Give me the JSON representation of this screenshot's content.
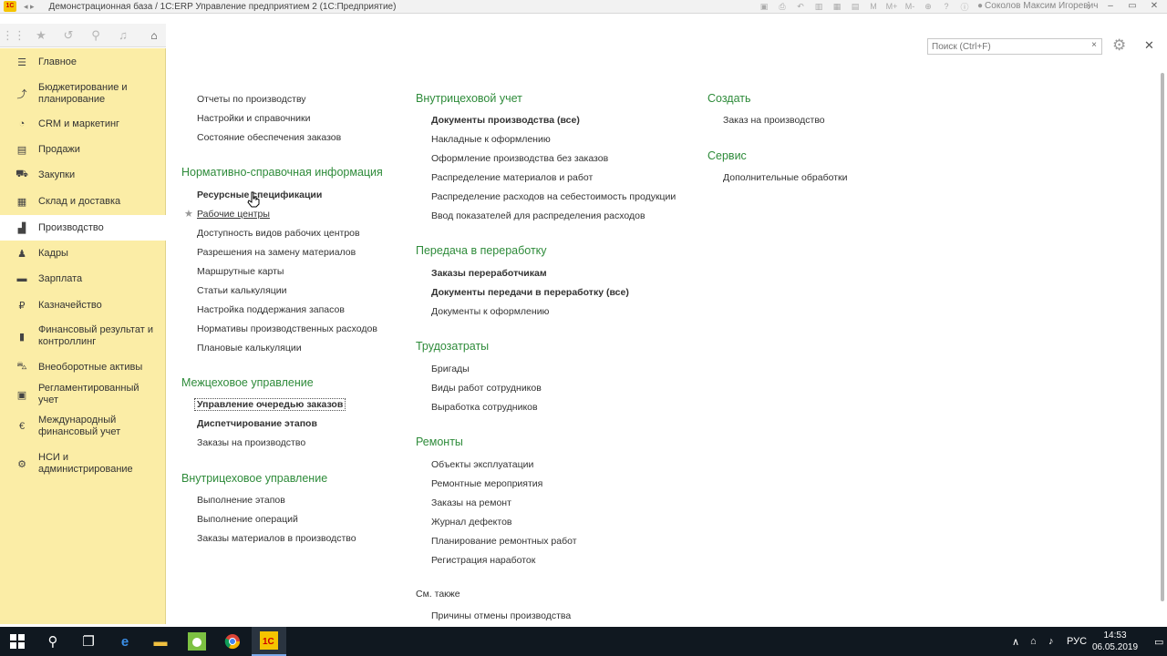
{
  "window": {
    "title": "Демонстрационная база / 1C:ERP Управление предприятием 2  (1С:Предприятие)",
    "user": "Соколов Максим Игоревич",
    "toolbar_icons": [
      "save-icon",
      "print-icon",
      "undo-icon",
      "table-icon",
      "calendar-icon",
      "calc-icon",
      "m-icon",
      "m-plus-icon",
      "m-minus-icon",
      "zoom-icon",
      "help-icon",
      "info-icon"
    ],
    "controls": [
      "–",
      "▭",
      "✕"
    ]
  },
  "sidebar": {
    "top_icons": [
      "apps-icon",
      "star-icon",
      "history-icon",
      "search-icon",
      "bell-icon",
      "home-icon"
    ],
    "items": [
      {
        "label": "Главное",
        "icon": "menu-icon",
        "glyph": "☰"
      },
      {
        "label": "Бюджетирование и планирование",
        "icon": "budget-icon",
        "glyph": "⤴"
      },
      {
        "label": "CRM и маркетинг",
        "icon": "crm-icon",
        "glyph": "◔"
      },
      {
        "label": "Продажи",
        "icon": "sales-icon",
        "glyph": "▤"
      },
      {
        "label": "Закупки",
        "icon": "cart-icon",
        "glyph": "⛟"
      },
      {
        "label": "Склад и доставка",
        "icon": "warehouse-icon",
        "glyph": "▦"
      },
      {
        "label": "Производство",
        "icon": "factory-icon",
        "glyph": "▟"
      },
      {
        "label": "Кадры",
        "icon": "personnel-icon",
        "glyph": "♟"
      },
      {
        "label": "Зарплата",
        "icon": "salary-icon",
        "glyph": "▬"
      },
      {
        "label": "Казначейство",
        "icon": "treasury-icon",
        "glyph": "₽"
      },
      {
        "label": "Финансовый результат и контроллинг",
        "icon": "finance-icon",
        "glyph": "▮"
      },
      {
        "label": "Внеоборотные активы",
        "icon": "assets-icon",
        "glyph": "⛍"
      },
      {
        "label": "Регламентированный учет",
        "icon": "accounting-icon",
        "glyph": "▣"
      },
      {
        "label": "Международный финансовый учет",
        "icon": "international-icon",
        "glyph": "€"
      },
      {
        "label": "НСИ и администрирование",
        "icon": "settings-icon",
        "glyph": "⚙"
      }
    ]
  },
  "search": {
    "placeholder": "Поиск (Ctrl+F)"
  },
  "main": {
    "col1": {
      "top_links": [
        "Отчеты по производству",
        "Настройки и справочники",
        "Состояние обеспечения заказов"
      ],
      "nsi": {
        "title": "Нормативно-справочная информация",
        "links": [
          "Ресурсные спецификации",
          "Рабочие центры",
          "Доступность видов рабочих центров",
          "Разрешения на замену материалов",
          "Маршрутные карты",
          "Статьи калькуляции",
          "Настройка поддержания запасов",
          "Нормативы производственных расходов",
          "Плановые калькуляции"
        ]
      },
      "mezh": {
        "title": "Межцеховое управление",
        "links": [
          "Управление очередью заказов",
          "Диспетчирование этапов",
          "Заказы на производство"
        ]
      },
      "vnutr_upr": {
        "title": "Внутрицеховое управление",
        "links": [
          "Выполнение этапов",
          "Выполнение операций",
          "Заказы материалов в производство"
        ]
      }
    },
    "col2": {
      "vnutr_uchet": {
        "title": "Внутрицеховой учет",
        "links": [
          "Документы производства (все)",
          "Накладные к оформлению",
          "Оформление производства без заказов",
          "Распределение материалов и работ",
          "Распределение расходов на себестоимость продукции",
          "Ввод показателей для распределения расходов"
        ]
      },
      "pererabotka": {
        "title": "Передача в переработку",
        "links": [
          "Заказы переработчикам",
          "Документы передачи в переработку (все)",
          "Документы к оформлению"
        ]
      },
      "trud": {
        "title": "Трудозатраты",
        "links": [
          "Бригады",
          "Виды работ сотрудников",
          "Выработка сотрудников"
        ]
      },
      "remonty": {
        "title": "Ремонты",
        "links": [
          "Объекты эксплуатации",
          "Ремонтные мероприятия",
          "Заказы на ремонт",
          "Журнал дефектов",
          "Планирование ремонтных работ",
          "Регистрация наработок"
        ]
      },
      "see_also": {
        "title": "См. также",
        "links": [
          "Причины отмены производства"
        ]
      }
    },
    "col3": {
      "create": {
        "title": "Создать",
        "links": [
          "Заказ на производство"
        ]
      },
      "service": {
        "title": "Сервис",
        "links": [
          "Дополнительные обработки"
        ]
      }
    }
  },
  "taskbar": {
    "apps": [
      "windows-start-icon",
      "search-icon",
      "task-view-icon",
      "edge-icon",
      "explorer-icon",
      "android-icon",
      "chrome-icon",
      "1c-icon"
    ],
    "language": "РУС",
    "time": "14:53",
    "date": "06.05.2019"
  }
}
